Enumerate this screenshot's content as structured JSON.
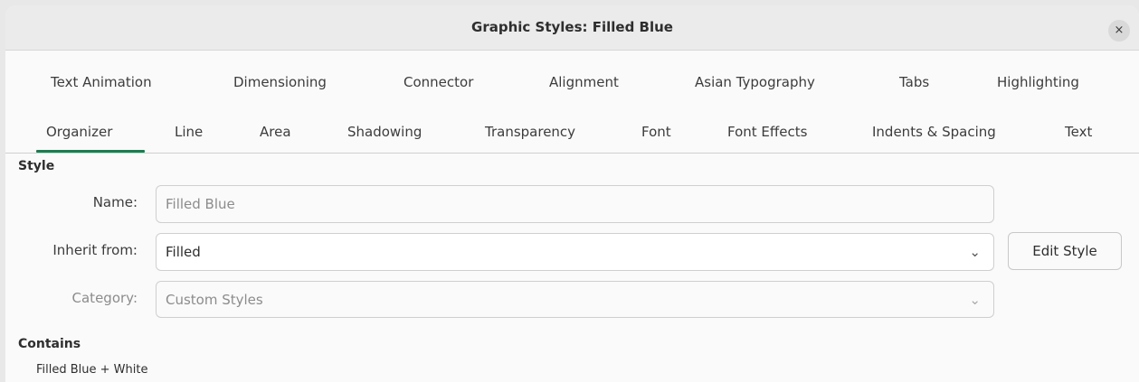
{
  "window": {
    "title": "Graphic Styles: Filled Blue",
    "close_label": "×"
  },
  "tabs_row1": [
    "Text Animation",
    "Dimensioning",
    "Connector",
    "Alignment",
    "Asian Typography",
    "Tabs",
    "Highlighting"
  ],
  "tabs_row2": [
    "Organizer",
    "Line",
    "Area",
    "Shadowing",
    "Transparency",
    "Font",
    "Font Effects",
    "Indents & Spacing",
    "Text"
  ],
  "active_tab": "Organizer",
  "style_section": {
    "heading": "Style",
    "name_label": "Name:",
    "name_value": "Filled Blue",
    "inherit_label": "Inherit from:",
    "inherit_value": "Filled",
    "category_label": "Category:",
    "category_value": "Custom Styles",
    "edit_button": "Edit Style"
  },
  "contains_section": {
    "heading": "Contains",
    "text": "Filled Blue + White"
  },
  "colors": {
    "accent": "#1f7a50"
  },
  "icons": {
    "close": "close-icon",
    "dropdown": "chevron-down-icon"
  }
}
